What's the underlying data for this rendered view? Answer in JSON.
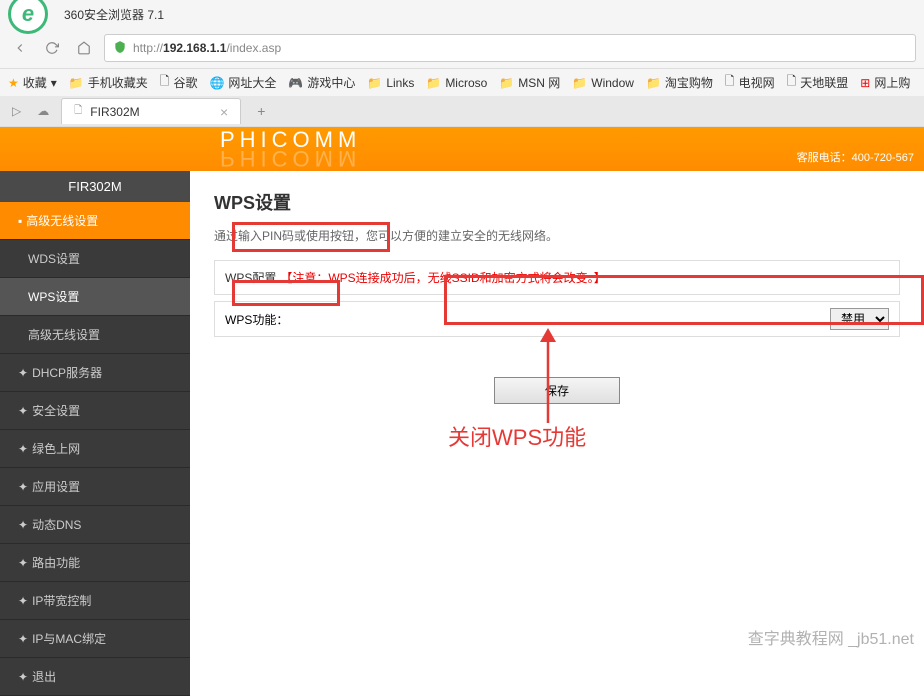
{
  "browser": {
    "title": "360安全浏览器 7.1",
    "url_prefix": "http://",
    "url_ip": "192.168.1.1",
    "url_path": "/index.asp",
    "bookmarks": {
      "favorites": "收藏",
      "items": [
        "手机收藏夹",
        "谷歌",
        "网址大全",
        "游戏中心",
        "Links",
        "Microso",
        "MSN 网",
        "Window",
        "淘宝购物",
        "电视网",
        "天地联盟",
        "网上购"
      ]
    },
    "tab": {
      "title": "FIR302M"
    }
  },
  "router": {
    "brand": "PHICOMM",
    "support": "客服电话：400-720-567",
    "model": "FIR302M",
    "sidebar": {
      "items": [
        {
          "label": "高级无线设置",
          "active": true,
          "sub": false
        },
        {
          "label": "WDS设置",
          "active": false,
          "sub": true
        },
        {
          "label": "WPS设置",
          "active": true,
          "sub": true
        },
        {
          "label": "高级无线设置",
          "active": false,
          "sub": true
        },
        {
          "label": "DHCP服务器",
          "active": false,
          "sub": false
        },
        {
          "label": "安全设置",
          "active": false,
          "sub": false
        },
        {
          "label": "绿色上网",
          "active": false,
          "sub": false
        },
        {
          "label": "应用设置",
          "active": false,
          "sub": false
        },
        {
          "label": "动态DNS",
          "active": false,
          "sub": false
        },
        {
          "label": "路由功能",
          "active": false,
          "sub": false
        },
        {
          "label": "IP带宽控制",
          "active": false,
          "sub": false
        },
        {
          "label": "IP与MAC绑定",
          "active": false,
          "sub": false
        },
        {
          "label": "退出",
          "active": false,
          "sub": false
        }
      ]
    },
    "content": {
      "title": "WPS设置",
      "desc": "通过输入PIN码或使用按钮，您可以方便的建立安全的无线网络。",
      "config_label": "WPS配置",
      "config_warning": "【注意：WPS连接成功后，无线SSID和加密方式将会改变。】",
      "wps_label": "WPS功能：",
      "wps_value": "禁用",
      "save": "保存"
    }
  },
  "annotation": {
    "text": "关闭WPS功能",
    "watermark": "查字典教程网 _jb51.net"
  }
}
